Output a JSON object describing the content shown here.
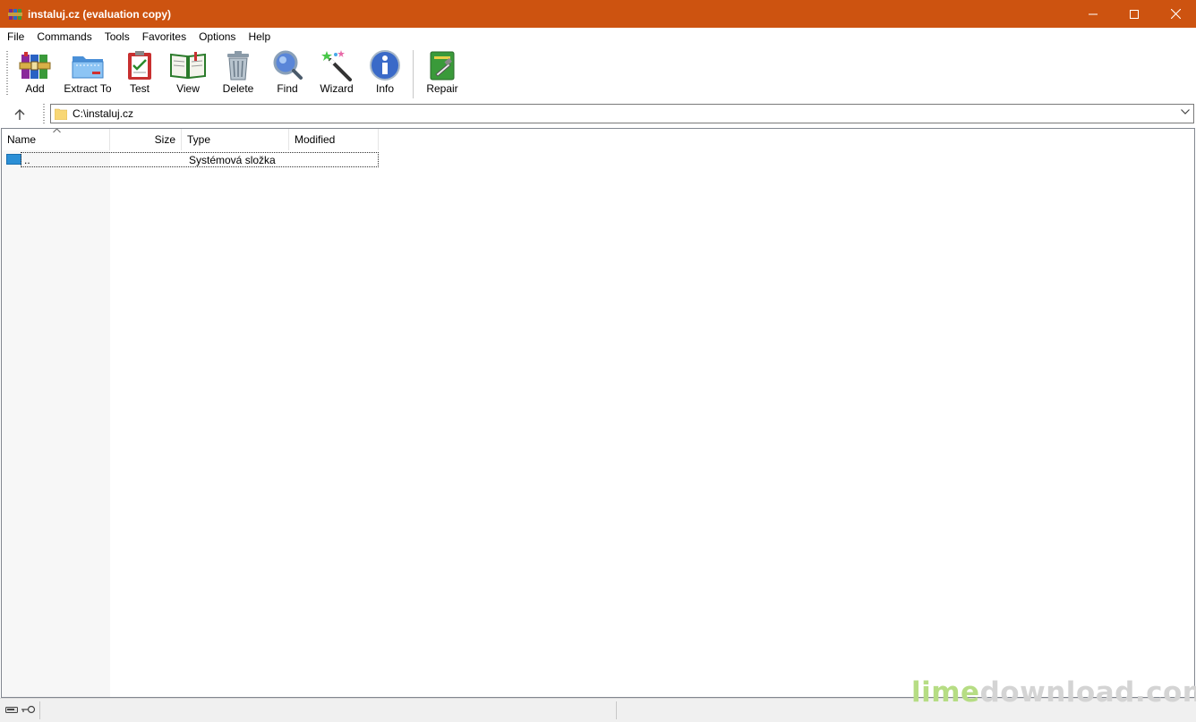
{
  "window": {
    "title": "instaluj.cz (evaluation copy)",
    "accent": "#cd5310"
  },
  "menu": [
    "File",
    "Commands",
    "Tools",
    "Favorites",
    "Options",
    "Help"
  ],
  "toolbar": {
    "add": "Add",
    "extract": "Extract To",
    "test": "Test",
    "view": "View",
    "delete": "Delete",
    "find": "Find",
    "wizard": "Wizard",
    "info": "Info",
    "repair": "Repair"
  },
  "address": {
    "path": "C:\\instaluj.cz"
  },
  "columns": {
    "name": "Name",
    "size": "Size",
    "type": "Type",
    "modified": "Modified"
  },
  "rows": [
    {
      "name": "..",
      "size": "",
      "type": "Systémová složka",
      "modified": ""
    }
  ],
  "watermark": {
    "part1": "lime",
    "part2": "download.com"
  }
}
